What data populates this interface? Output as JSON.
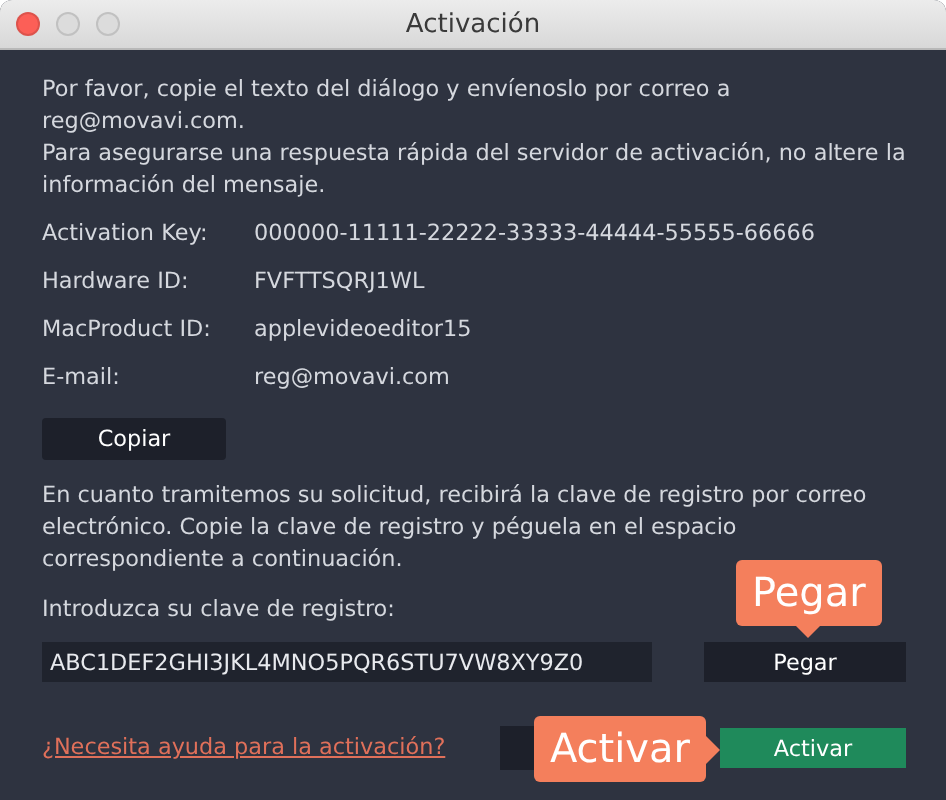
{
  "window": {
    "title": "Activación",
    "controls": [
      {
        "kind": "close"
      },
      {
        "kind": "minimize"
      },
      {
        "kind": "zoom"
      }
    ]
  },
  "intro": [
    "Por favor, copie el texto del diálogo y envíenoslo por correo a reg@movavi.com.",
    "Para asegurarse una respuesta rápida del servidor de activación, no altere la información del mensaje."
  ],
  "fields": [
    {
      "label": "Activation Key:",
      "value": "000000-11111-22222-33333-44444-55555-66666"
    },
    {
      "label": "Hardware ID:",
      "value": "FVFTTSQRJ1WL"
    },
    {
      "label": "MacProduct ID:",
      "value": "applevideoeditor15"
    },
    {
      "label": "E-mail:",
      "value": "reg@movavi.com"
    }
  ],
  "copy_button": "Copiar",
  "instructions": "En cuanto tramitemos su solicitud, recibirá la clave de registro por correo electrónico. Copie la clave de registro y péguela en el espacio correspondiente a continuación.",
  "key_label": "Introduzca su clave de registro:",
  "key_field": {
    "value": "ABC1DEF2GHI3JKL4MNO5PQR6STU7VW8XY9Z0"
  },
  "paste_button": {
    "label": "Pegar",
    "callout": "Pegar"
  },
  "help_link": "¿Necesita ayuda para la activación?",
  "activate_button": {
    "label": "Activar",
    "callout": "Activar"
  }
}
